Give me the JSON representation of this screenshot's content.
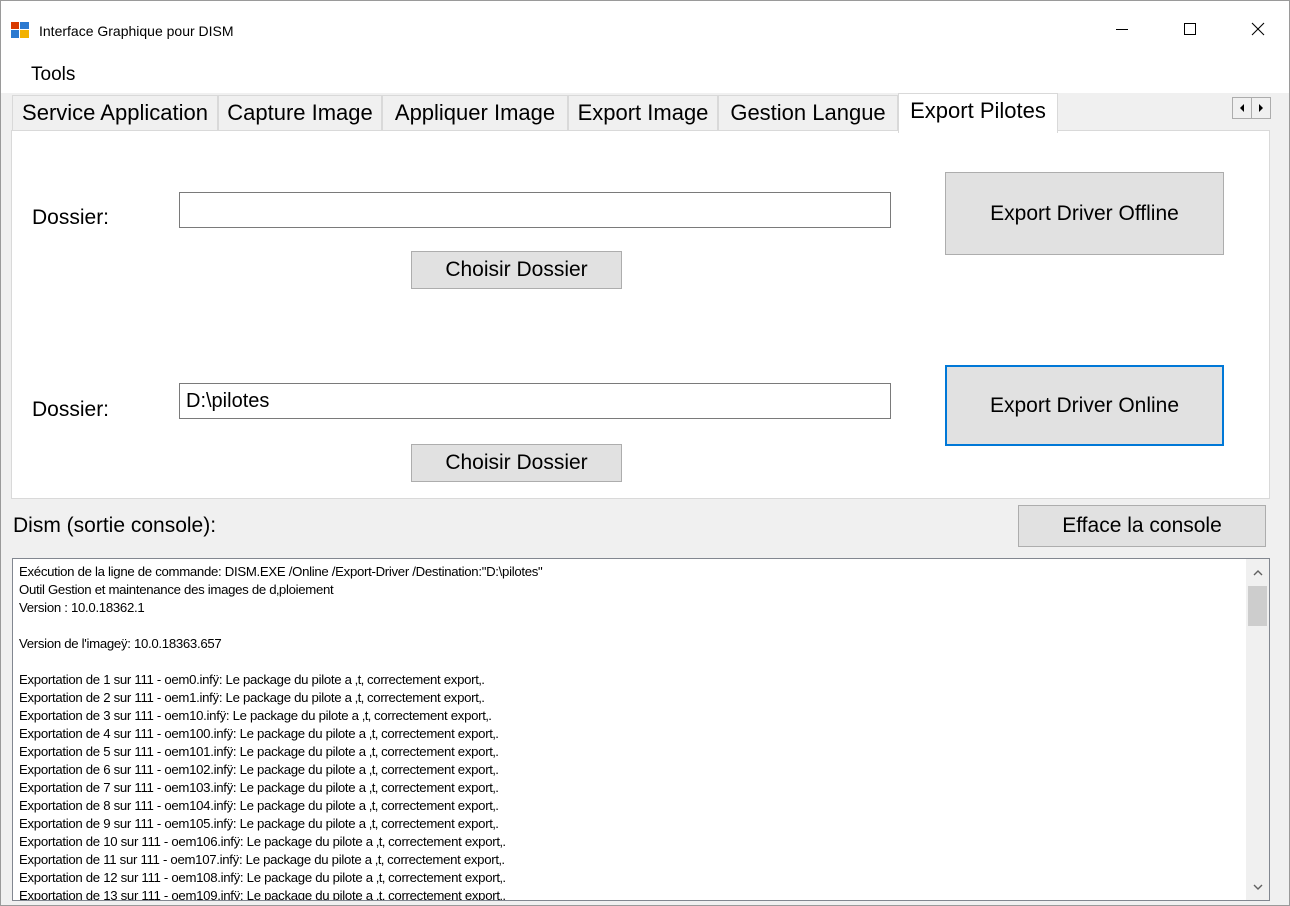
{
  "window": {
    "title": "Interface Graphique pour DISM"
  },
  "menu": {
    "items": [
      {
        "label": "Tools"
      }
    ]
  },
  "tabs": {
    "items": [
      {
        "label": "Service Application"
      },
      {
        "label": "Capture Image"
      },
      {
        "label": "Appliquer Image"
      },
      {
        "label": "Export Image"
      },
      {
        "label": "Gestion Langue"
      },
      {
        "label": "Export Pilotes"
      }
    ],
    "active_index": 5
  },
  "offline": {
    "folder_label": "Dossier:",
    "folder_value": "",
    "choose_label": "Choisir Dossier",
    "export_label": "Export Driver Offline"
  },
  "online": {
    "folder_label": "Dossier:",
    "folder_value": "D:\\pilotes",
    "choose_label": "Choisir Dossier",
    "export_label": "Export Driver Online"
  },
  "console": {
    "label": "Dism (sortie console):",
    "clear_label": "Efface la console",
    "lines": [
      "Exécution de la ligne de commande: DISM.EXE /Online /Export-Driver /Destination:\"D:\\pilotes\"",
      "Outil Gestion et maintenance des images de d‚ploiement",
      "Version : 10.0.18362.1",
      "",
      "Version de l'imageÿ: 10.0.18363.657",
      "",
      "Exportation de 1 sur 111 - oem0.infÿ: Le package du pilote a ‚t‚ correctement export‚.",
      "Exportation de 2 sur 111 - oem1.infÿ: Le package du pilote a ‚t‚ correctement export‚.",
      "Exportation de 3 sur 111 - oem10.infÿ: Le package du pilote a ‚t‚ correctement export‚.",
      "Exportation de 4 sur 111 - oem100.infÿ: Le package du pilote a ‚t‚ correctement export‚.",
      "Exportation de 5 sur 111 - oem101.infÿ: Le package du pilote a ‚t‚ correctement export‚.",
      "Exportation de 6 sur 111 - oem102.infÿ: Le package du pilote a ‚t‚ correctement export‚.",
      "Exportation de 7 sur 111 - oem103.infÿ: Le package du pilote a ‚t‚ correctement export‚.",
      "Exportation de 8 sur 111 - oem104.infÿ: Le package du pilote a ‚t‚ correctement export‚.",
      "Exportation de 9 sur 111 - oem105.infÿ: Le package du pilote a ‚t‚ correctement export‚.",
      "Exportation de 10 sur 111 - oem106.infÿ: Le package du pilote a ‚t‚ correctement export‚.",
      "Exportation de 11 sur 111 - oem107.infÿ: Le package du pilote a ‚t‚ correctement export‚.",
      "Exportation de 12 sur 111 - oem108.infÿ: Le package du pilote a ‚t‚ correctement export‚.",
      "Exportation de 13 sur 111 - oem109.infÿ: Le package du pilote a ‚t‚ correctement export‚."
    ]
  },
  "colors": {
    "focus_border": "#0078d7",
    "button_face": "#e1e1e1",
    "window_bg": "#f0f0f0"
  }
}
